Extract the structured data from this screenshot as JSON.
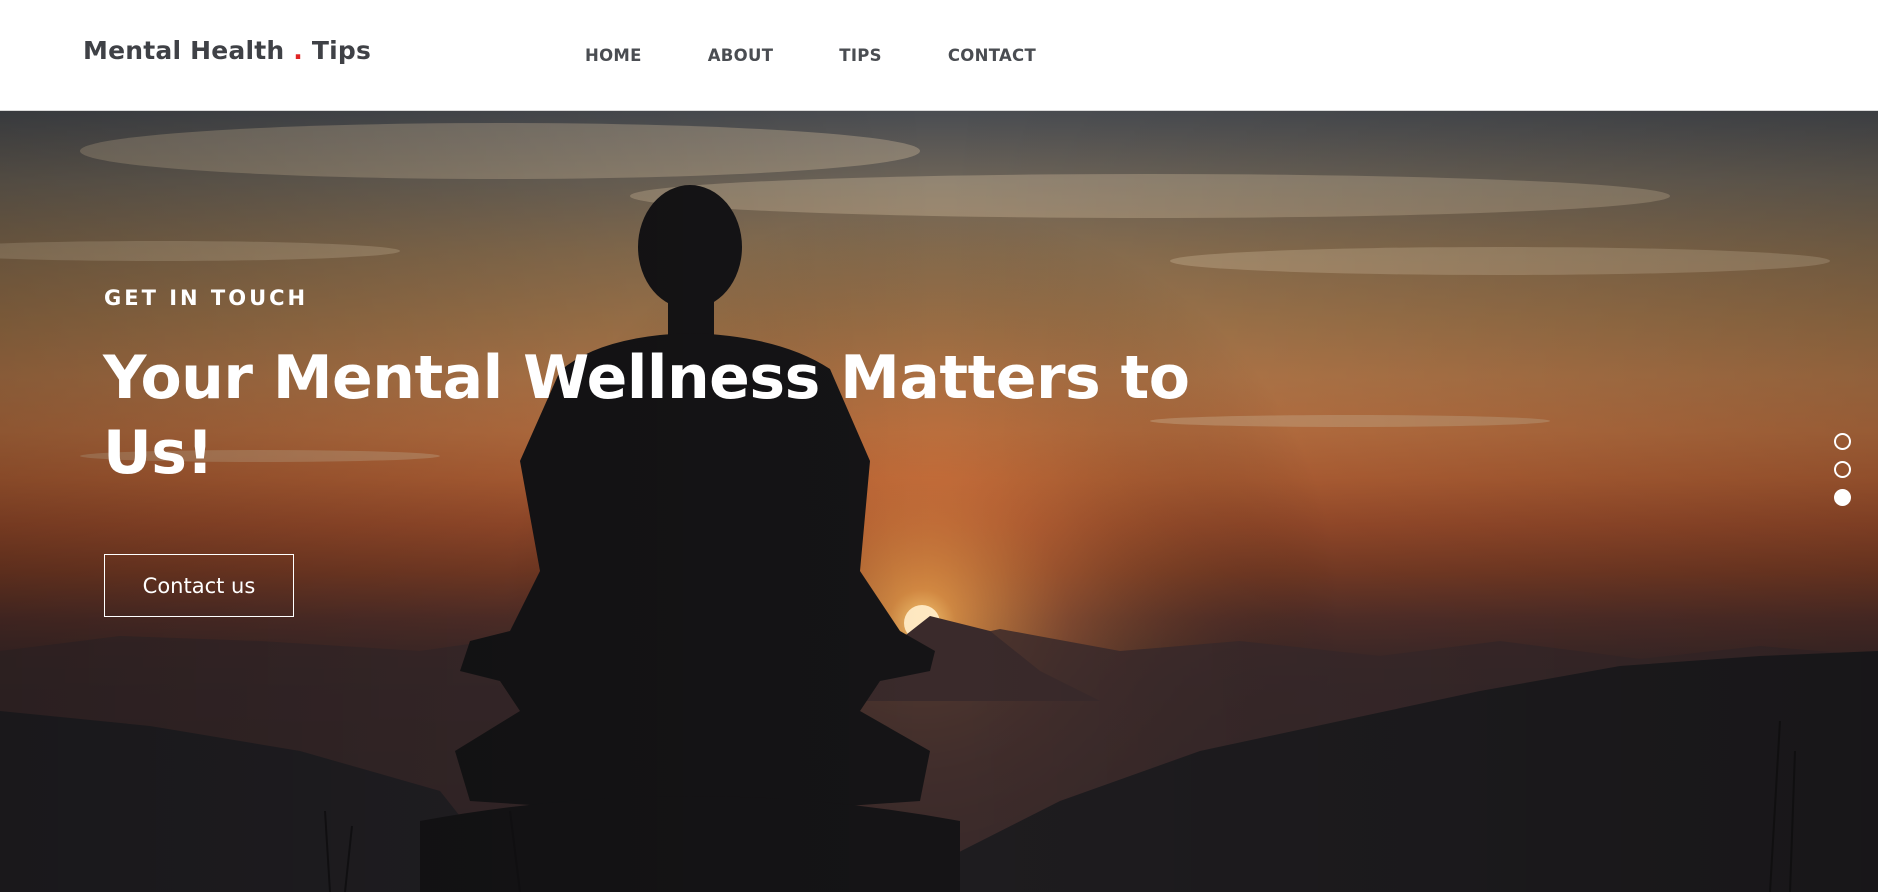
{
  "header": {
    "logo": {
      "part1": "Mental Health ",
      "dot": ".",
      "part2": " Tips"
    },
    "nav": [
      {
        "label": "HOME"
      },
      {
        "label": "ABOUT"
      },
      {
        "label": "TIPS"
      },
      {
        "label": "CONTACT"
      }
    ]
  },
  "hero": {
    "kicker": "GET IN TOUCH",
    "headline": "Your Mental Wellness Matters to Us!",
    "cta_label": "Contact us",
    "background": "meditating-silhouette-sunset-photo",
    "slides": {
      "count": 3,
      "active": 3
    }
  },
  "colors": {
    "logo_dot": "#e02424",
    "text_dark": "#3f4146",
    "hero_text": "#ffffff"
  }
}
